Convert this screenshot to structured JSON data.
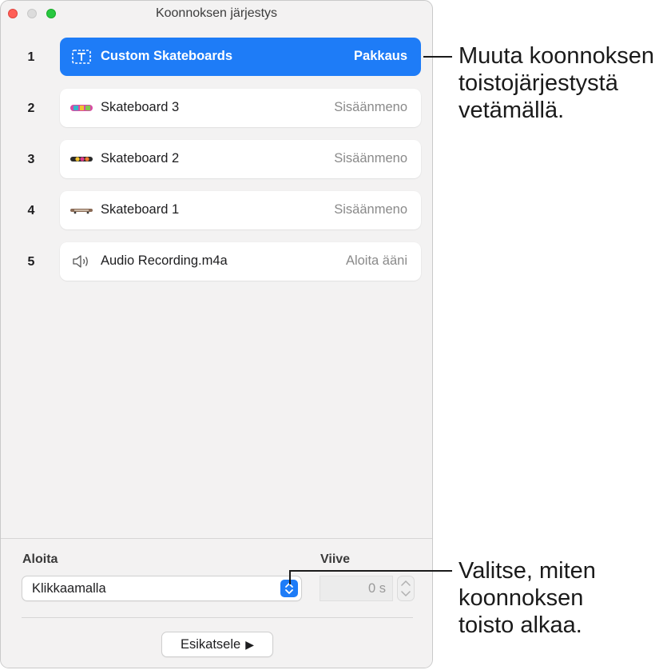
{
  "window": {
    "title": "Koonnoksen järjestys"
  },
  "rows": [
    {
      "num": "1",
      "name": "Custom Skateboards",
      "effect": "Pakkaus",
      "icon": "text-box-icon",
      "selected": true
    },
    {
      "num": "2",
      "name": "Skateboard 3",
      "effect": "Sisäänmeno",
      "icon": "skateboard-thumbnail"
    },
    {
      "num": "3",
      "name": "Skateboard 2",
      "effect": "Sisäänmeno",
      "icon": "skateboard-thumbnail"
    },
    {
      "num": "4",
      "name": "Skateboard 1",
      "effect": "Sisäänmeno",
      "icon": "skateboard-thumbnail"
    },
    {
      "num": "5",
      "name": "Audio Recording.m4a",
      "effect": "Aloita ääni",
      "icon": "speaker-icon"
    }
  ],
  "controls": {
    "start_label": "Aloita",
    "start_value": "Klikkaamalla",
    "delay_label": "Viive",
    "delay_value": "0 s",
    "preview_label": "Esikatsele"
  },
  "callouts": {
    "reorder": [
      "Muuta koonnoksen",
      "toistojärjestystä",
      "vetämällä."
    ],
    "start": [
      "Valitse, miten",
      "koonnoksen",
      "toisto alkaa."
    ]
  },
  "colors": {
    "accent": "#1e7cf7",
    "close": "#ff5f57",
    "zoom": "#28c840"
  }
}
